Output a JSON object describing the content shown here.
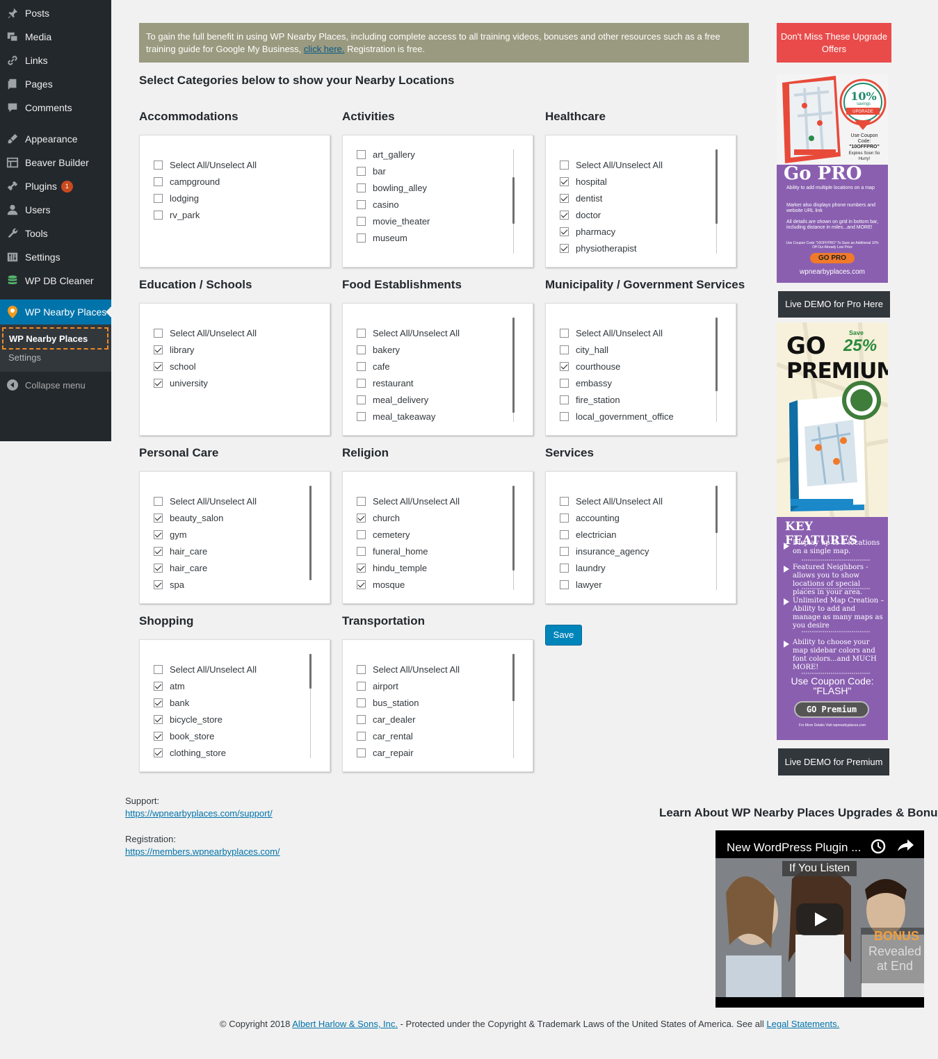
{
  "sidebar": {
    "items": [
      {
        "label": "Posts",
        "icon": "pin-icon"
      },
      {
        "label": "Media",
        "icon": "media-icon"
      },
      {
        "label": "Links",
        "icon": "link-icon"
      },
      {
        "label": "Pages",
        "icon": "pages-icon"
      },
      {
        "label": "Comments",
        "icon": "comment-icon"
      },
      {
        "label": "Appearance",
        "icon": "brush-icon"
      },
      {
        "label": "Beaver Builder",
        "icon": "grid-icon"
      },
      {
        "label": "Plugins",
        "icon": "plug-icon",
        "badge": "1"
      },
      {
        "label": "Users",
        "icon": "user-icon"
      },
      {
        "label": "Tools",
        "icon": "wrench-icon"
      },
      {
        "label": "Settings",
        "icon": "sliders-icon"
      },
      {
        "label": "WP DB Cleaner",
        "icon": "database-icon"
      }
    ],
    "current": "WP Nearby Places",
    "submenu": [
      "WP Nearby Places",
      "Settings"
    ],
    "collapse": "Collapse menu"
  },
  "notice": {
    "text": "To gain the full benefit in using WP Nearby Places, including complete access to all training videos, bonuses and other resources such as a free training guide for Google My Business,",
    "link": "click here.",
    "after": " Registration is free."
  },
  "heading": "Select Categories below to show your Nearby Locations",
  "categories": [
    {
      "title": "Accommodations",
      "items": [
        [
          "Select All/Unselect All",
          false
        ],
        [
          "campground",
          false
        ],
        [
          "lodging",
          false
        ],
        [
          "rv_park",
          false
        ]
      ]
    },
    {
      "title": "Activities",
      "items": [
        [
          "art_gallery",
          false
        ],
        [
          "bar",
          false
        ],
        [
          "bowling_alley",
          false
        ],
        [
          "casino",
          false
        ],
        [
          "movie_theater",
          false
        ],
        [
          "museum",
          false
        ]
      ]
    },
    {
      "title": "Healthcare",
      "items": [
        [
          "Select All/Unselect All",
          false
        ],
        [
          "hospital",
          true
        ],
        [
          "dentist",
          true
        ],
        [
          "doctor",
          true
        ],
        [
          "pharmacy",
          true
        ],
        [
          "physiotherapist",
          true
        ]
      ]
    },
    {
      "title": "Education / Schools",
      "items": [
        [
          "Select All/Unselect All",
          false
        ],
        [
          "library",
          true
        ],
        [
          "school",
          true
        ],
        [
          "university",
          true
        ]
      ]
    },
    {
      "title": "Food Establishments",
      "items": [
        [
          "Select All/Unselect All",
          false
        ],
        [
          "bakery",
          false
        ],
        [
          "cafe",
          false
        ],
        [
          "restaurant",
          false
        ],
        [
          "meal_delivery",
          false
        ],
        [
          "meal_takeaway",
          false
        ]
      ]
    },
    {
      "title": "Municipality / Government Services",
      "items": [
        [
          "Select All/Unselect All",
          false
        ],
        [
          "city_hall",
          false
        ],
        [
          "courthouse",
          true
        ],
        [
          "embassy",
          false
        ],
        [
          "fire_station",
          false
        ],
        [
          "local_government_office",
          false
        ]
      ]
    },
    {
      "title": "Personal Care",
      "items": [
        [
          "Select All/Unselect All",
          false
        ],
        [
          "beauty_salon",
          true
        ],
        [
          "gym",
          true
        ],
        [
          "hair_care",
          true
        ],
        [
          "hair_care",
          true
        ],
        [
          "spa",
          true
        ]
      ]
    },
    {
      "title": "Religion",
      "items": [
        [
          "Select All/Unselect All",
          false
        ],
        [
          "church",
          true
        ],
        [
          "cemetery",
          false
        ],
        [
          "funeral_home",
          false
        ],
        [
          "hindu_temple",
          true
        ],
        [
          "mosque",
          true
        ]
      ]
    },
    {
      "title": "Services",
      "items": [
        [
          "Select All/Unselect All",
          false
        ],
        [
          "accounting",
          false
        ],
        [
          "electrician",
          false
        ],
        [
          "insurance_agency",
          false
        ],
        [
          "laundry",
          false
        ],
        [
          "lawyer",
          false
        ]
      ]
    },
    {
      "title": "Shopping",
      "items": [
        [
          "Select All/Unselect All",
          false
        ],
        [
          "atm",
          true
        ],
        [
          "bank",
          true
        ],
        [
          "bicycle_store",
          true
        ],
        [
          "book_store",
          true
        ],
        [
          "clothing_store",
          true
        ]
      ]
    },
    {
      "title": "Transportation",
      "items": [
        [
          "Select All/Unselect All",
          false
        ],
        [
          "airport",
          false
        ],
        [
          "bus_station",
          false
        ],
        [
          "car_dealer",
          false
        ],
        [
          "car_rental",
          false
        ],
        [
          "car_repair",
          false
        ]
      ]
    }
  ],
  "save_label": "Save",
  "ads": {
    "dont_miss": "Don't Miss These Upgrade Offers",
    "pro": {
      "savings_pct": "10%",
      "savings": "savings",
      "upgrade": "UPGRADE",
      "coupon_text": "Use Coupon Code:",
      "coupon_code": "\"10OFFPRO\"",
      "expires": "Expires Soon So Hurry!",
      "title": "Go PRO",
      "features": [
        "Ability to add multiple locations on a map",
        "Marker also displays phone numbers and website URL link",
        "All details are shown on grid in bottom bar, including distance in miles...and MORE!"
      ],
      "small": "Use Coupon Code \"10OFFPRO\" To Save an Additional 10% Off Our Already Low Price",
      "button": "GO PRO",
      "site": "wpnearbyplaces.com"
    },
    "live_demo_pro": "Live DEMO for Pro Here",
    "premium": {
      "title1": "GO",
      "title2": "PREMIUM",
      "save": "Save",
      "pct": "25%",
      "key": "KEY FEATURES",
      "features": [
        "Display up to 3 locations on a single map.",
        "Featured Neighbors -allows you to show locations of special places in your area.",
        "Unlimited Map Creation – Ability to add and manage as many maps as you desire",
        "Ability to choose your map sidebar colors and font colors...and MUCH MORE!"
      ],
      "coupon": "Use Coupon Code: \"FLASH\"",
      "button": "GO Premium",
      "small": "For More Details Visit wpnearbyplaces.com"
    },
    "live_demo_premium": "Live DEMO for Premium"
  },
  "support": {
    "label": "Support:",
    "url": "https://wpnearbyplaces.com/support/"
  },
  "registration": {
    "label": "Registration:",
    "url": "https://members.wpnearbyplaces.com/"
  },
  "learn_heading": "Learn About WP Nearby Places Upgrades & Bonuses",
  "video": {
    "title": "New WordPress Plugin ...",
    "caption": "If You Listen",
    "bonus1": "BONUS",
    "bonus2": "Revealed",
    "bonus3": "at End"
  },
  "copyright": {
    "pre": "© Copyright 2018 ",
    "company": "Albert Harlow & Sons, Inc.",
    "mid": " - Protected under the Copyright & Trademark Laws of the United States of America. See all ",
    "legal": "Legal Statements."
  },
  "colors": {
    "sidebar": "#23282d",
    "accent": "#0073aa",
    "notice": "#999a7f",
    "offer": "#e94b4b",
    "pro_purple": "#8a5fb0"
  }
}
